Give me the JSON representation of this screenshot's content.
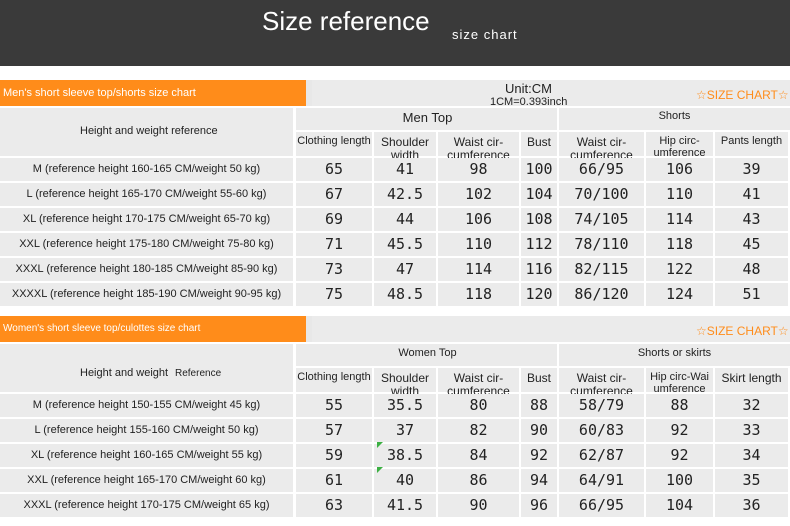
{
  "header": {
    "title": "Size reference",
    "subtitle": "size chart"
  },
  "men": {
    "banner": "Men's short sleeve top/shorts size chart",
    "unit": "Unit:CM",
    "conversion": "1CM=0.393inch",
    "badge": "☆SIZE CHART☆",
    "ref_header": "Height and weight reference",
    "group_top": "Men Top",
    "group_bottom": "Shorts",
    "columns": [
      "Clothing length",
      "Shoulder width",
      "Waist cir-cumference",
      "Bust",
      "Waist cir-cumference",
      "Hip circ-umference",
      "Pants length"
    ],
    "rows": [
      {
        "label": "M (reference height 160-165 CM/weight 50 kg)",
        "values": [
          "65",
          "41",
          "98",
          "100",
          "66/95",
          "106",
          "39"
        ]
      },
      {
        "label": "L (reference height 165-170 CM/weight 55-60 kg)",
        "values": [
          "67",
          "42.5",
          "102",
          "104",
          "70/100",
          "110",
          "41"
        ]
      },
      {
        "label": "XL (reference height 170-175 CM/weight 65-70 kg)",
        "values": [
          "69",
          "44",
          "106",
          "108",
          "74/105",
          "114",
          "43"
        ]
      },
      {
        "label": "XXL (reference height 175-180 CM/weight 75-80 kg)",
        "values": [
          "71",
          "45.5",
          "110",
          "112",
          "78/110",
          "118",
          "45"
        ]
      },
      {
        "label": "XXXL (reference height 180-185 CM/weight 85-90 kg)",
        "values": [
          "73",
          "47",
          "114",
          "116",
          "82/115",
          "122",
          "48"
        ]
      },
      {
        "label": "XXXXL (reference height 185-190 CM/weight 90-95 kg)",
        "values": [
          "75",
          "48.5",
          "118",
          "120",
          "86/120",
          "124",
          "51"
        ]
      }
    ]
  },
  "women": {
    "banner": "Women's short sleeve top/culottes size chart",
    "badge": "☆SIZE CHART☆",
    "ref_header_a": "Height and weight",
    "ref_header_b": "Reference",
    "group_top": "Women Top",
    "group_bottom": "Shorts or skirts",
    "columns": [
      "Clothing length",
      "Shoulder width",
      "Waist cir-cumference",
      "Bust",
      "Waist cir-cumference",
      "Hip circ-Wai umference",
      "Skirt length"
    ],
    "rows": [
      {
        "label": "M (reference height 150-155 CM/weight 45 kg)",
        "values": [
          "55",
          "35.5",
          "80",
          "88",
          "58/79",
          "88",
          "32"
        ]
      },
      {
        "label": "L (reference height 155-160 CM/weight 50 kg)",
        "values": [
          "57",
          "37",
          "82",
          "90",
          "60/83",
          "92",
          "33"
        ]
      },
      {
        "label": "XL (reference height 160-165 CM/weight 55 kg)",
        "values": [
          "59",
          "38.5",
          "84",
          "92",
          "62/87",
          "92",
          "34"
        ]
      },
      {
        "label": "XXL (reference height 165-170 CM/weight 60 kg)",
        "values": [
          "61",
          "40",
          "86",
          "94",
          "64/91",
          "100",
          "35"
        ]
      },
      {
        "label": "XXXL (reference height 170-175 CM/weight 65 kg)",
        "values": [
          "63",
          "41.5",
          "90",
          "96",
          "66/95",
          "104",
          "36"
        ]
      }
    ]
  }
}
